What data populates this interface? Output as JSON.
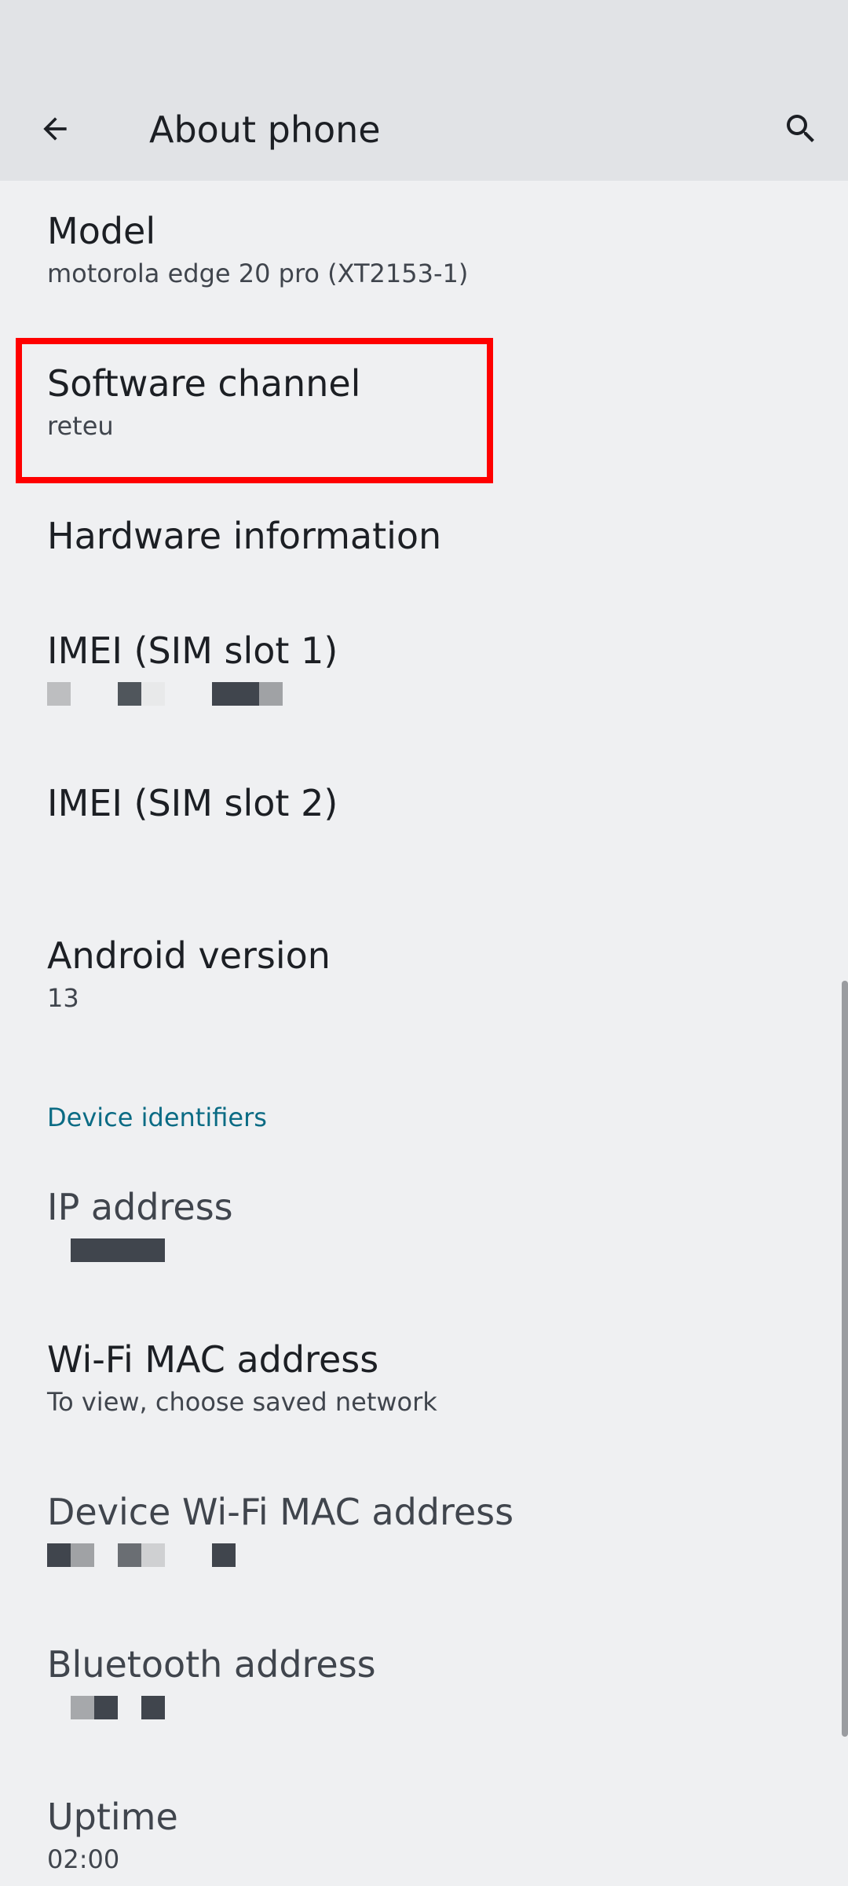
{
  "app_bar": {
    "title": "About phone",
    "back_icon": "arrow-left-icon",
    "search_icon": "search-icon"
  },
  "items": {
    "model": {
      "title": "Model",
      "summary": "motorola edge 20 pro (XT2153-1)"
    },
    "software_channel": {
      "title": "Software channel",
      "summary": "reteu"
    },
    "hardware_information": {
      "title": "Hardware information"
    },
    "imei_slot1": {
      "title": "IMEI (SIM slot 1)"
    },
    "imei_slot2": {
      "title": "IMEI (SIM slot 2)"
    },
    "android_version": {
      "title": "Android version",
      "summary": "13"
    },
    "ip_address": {
      "title": "IP address"
    },
    "wifi_mac": {
      "title": "Wi-Fi MAC address",
      "summary": "To view, choose saved network"
    },
    "device_wifi_mac": {
      "title": "Device Wi-Fi MAC address"
    },
    "bluetooth_address": {
      "title": "Bluetooth address"
    },
    "uptime": {
      "title": "Uptime",
      "summary": "02:00"
    }
  },
  "sections": {
    "device_identifiers": "Device identifiers"
  },
  "colors": {
    "background": "#eff0f2",
    "app_bar": "#e1e3e6",
    "accent": "#0a6b84",
    "highlight": "#ff0000"
  }
}
